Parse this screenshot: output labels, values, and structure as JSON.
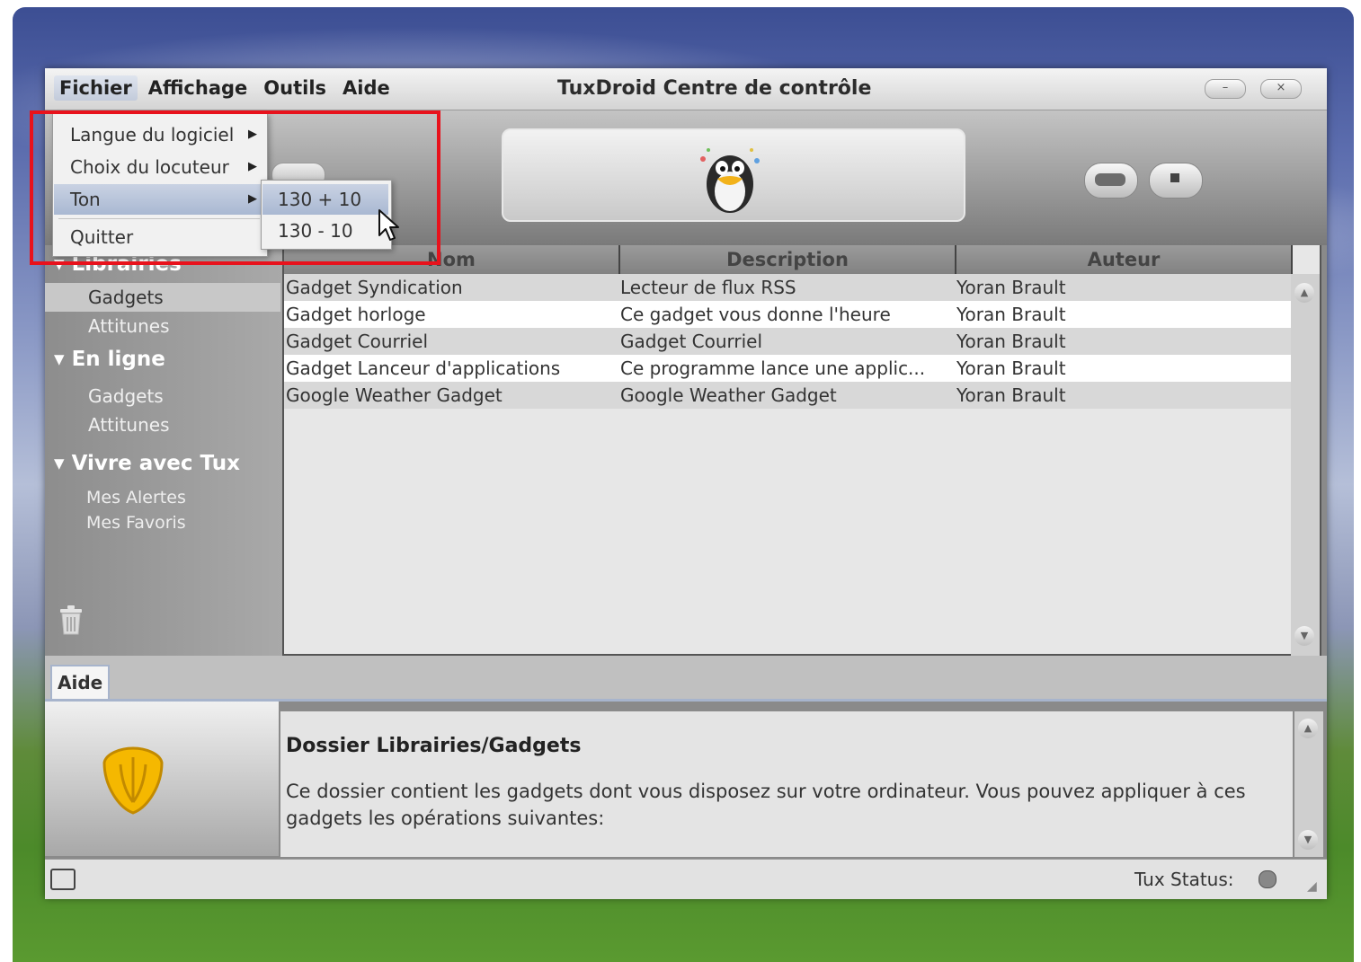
{
  "window": {
    "title": "TuxDroid Centre de contrôle",
    "minimize_label": "–",
    "close_label": "×"
  },
  "menubar": [
    "Fichier",
    "Affichage",
    "Outils",
    "Aide"
  ],
  "fichier_menu": {
    "items": [
      {
        "label": "Langue du logiciel",
        "has_submenu": true
      },
      {
        "label": "Choix du locuteur",
        "has_submenu": true
      },
      {
        "label": "Ton",
        "has_submenu": true
      },
      {
        "label": "Quitter",
        "has_submenu": false
      }
    ],
    "ton_submenu": [
      "130 + 10",
      "130  - 10"
    ]
  },
  "sidebar": {
    "sections": [
      {
        "title": "Librairies",
        "items": [
          "Gadgets",
          "Attitunes"
        ],
        "selected": "Gadgets"
      },
      {
        "title": "En ligne",
        "items": [
          "Gadgets",
          "Attitunes"
        ]
      },
      {
        "title": "Vivre avec Tux",
        "items": [
          "Mes Alertes",
          "Mes Favoris"
        ]
      }
    ]
  },
  "table": {
    "columns": [
      "Nom",
      "Description",
      "Auteur"
    ],
    "rows": [
      [
        "Gadget Syndication",
        "Lecteur de flux RSS",
        "Yoran Brault"
      ],
      [
        "Gadget horloge",
        "Ce gadget vous donne l'heure",
        "Yoran Brault"
      ],
      [
        "Gadget Courriel",
        "Gadget Courriel",
        "Yoran Brault"
      ],
      [
        "Gadget Lanceur d'applications",
        "Ce programme lance une applic...",
        "Yoran Brault"
      ],
      [
        "Google Weather Gadget",
        "Google Weather Gadget",
        "Yoran Brault"
      ]
    ]
  },
  "help": {
    "tab_label": "Aide",
    "title": "Dossier Librairies/Gadgets",
    "text": "Ce dossier contient les gadgets dont vous disposez sur votre ordinateur. Vous pouvez appliquer à ces gadgets les opérations suivantes:"
  },
  "status": {
    "label": "Tux Status:"
  },
  "colors": {
    "highlight_box": "#e8121c",
    "menu_highlight": "#b6c3da"
  }
}
